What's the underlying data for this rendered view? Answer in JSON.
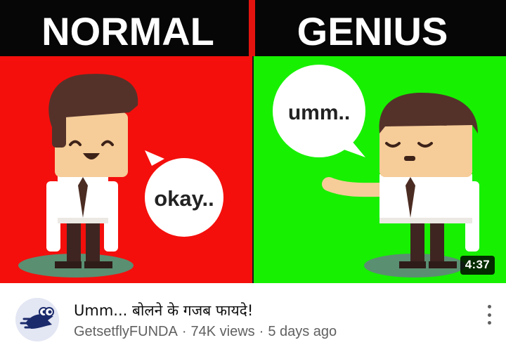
{
  "thumbnail": {
    "left_heading": "NORMAL",
    "right_heading": "GENIUS",
    "left_bubble": "okay..",
    "right_bubble": "umm..",
    "duration": "4:37",
    "colors": {
      "left_bg": "#f40f0c",
      "right_bg": "#17f000",
      "header_bg": "#060606"
    }
  },
  "video": {
    "title": "Umm... बोलने के गजब फायदे!",
    "channel": "GetsetflyFUNDA",
    "views": "74K views",
    "age": "5 days ago",
    "separator": "·"
  },
  "icons": {
    "avatar": "channel-bird-logo-icon",
    "menu": "more-vert-icon"
  }
}
